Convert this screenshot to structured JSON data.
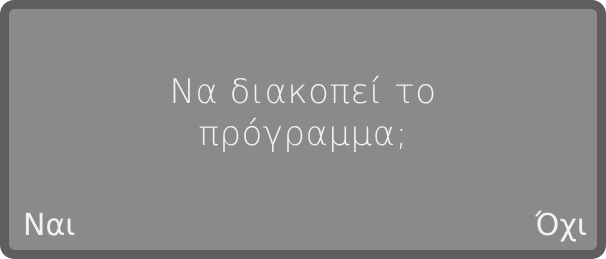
{
  "dialog": {
    "message_line1": "Να διακοπεί το",
    "message_line2": "πρόγραμμα;",
    "left_option": "Ναι",
    "right_option": "Όχι"
  },
  "colors": {
    "bezel": "#5e5e5e",
    "screen": "#8a8a8c",
    "text": "#f2f2f2"
  }
}
